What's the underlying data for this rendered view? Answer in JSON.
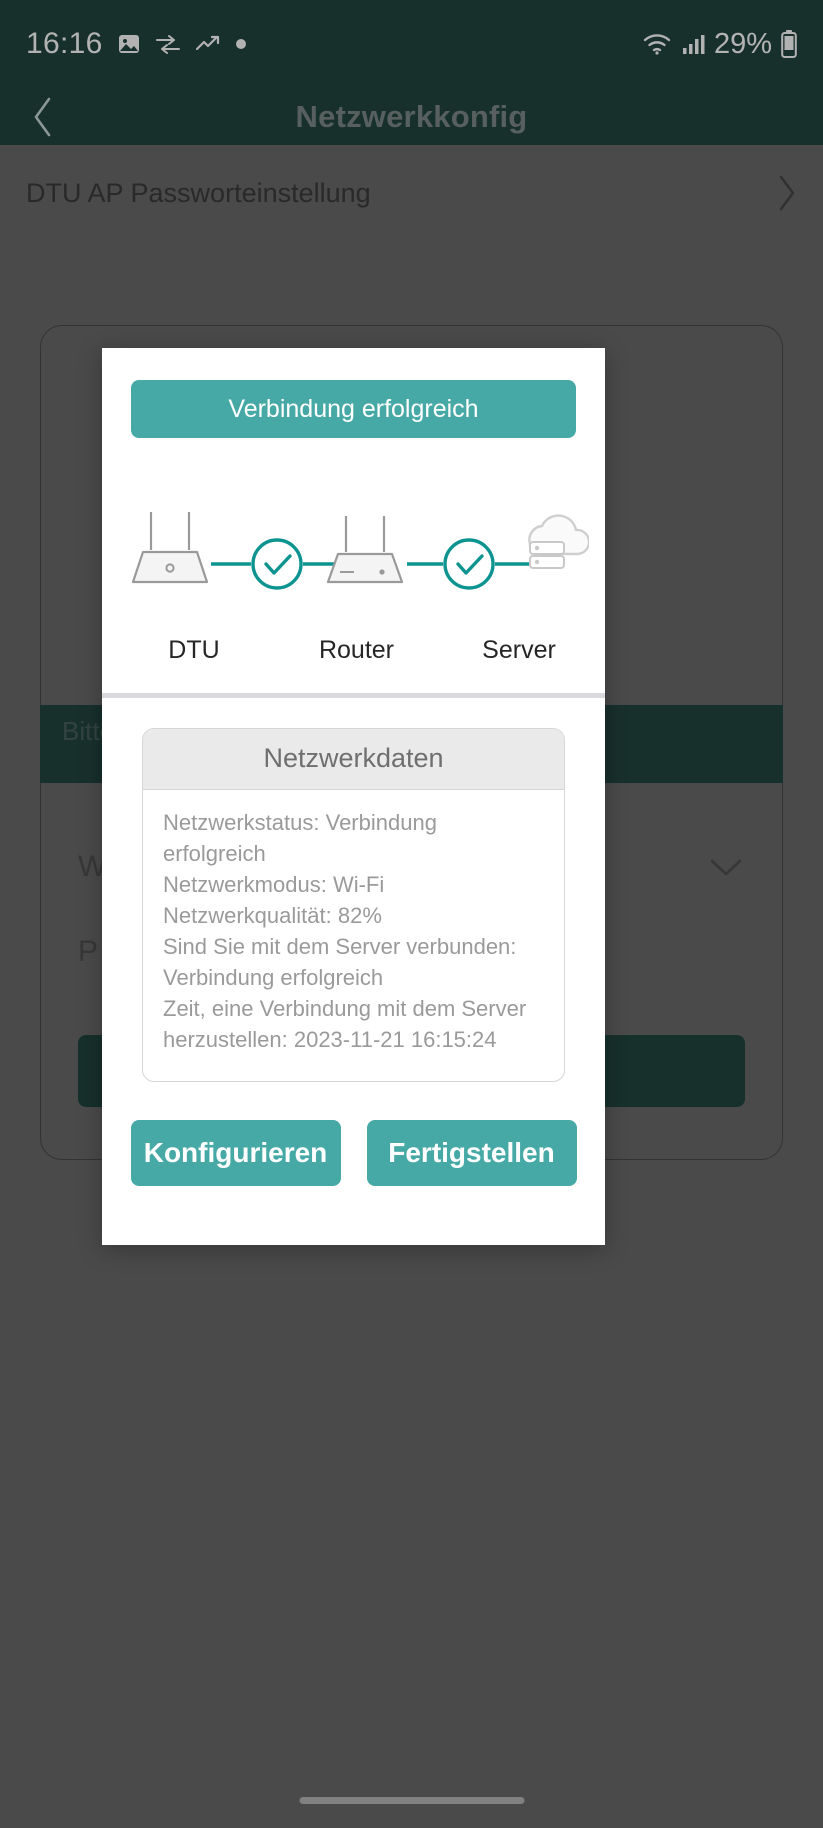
{
  "status_bar": {
    "time": "16:16",
    "battery_percent": "29%",
    "left_icons": [
      "image-icon",
      "data-transfer-icon",
      "trending-up-icon",
      "dot-icon"
    ],
    "right_icons": [
      "wifi-icon",
      "cellular-signal-icon",
      "battery-icon"
    ]
  },
  "app_bar": {
    "title": "Netzwerkkonfig",
    "back_icon": "chevron-left-icon"
  },
  "background_screen": {
    "row_label": "DTU AP Passworteinstellung",
    "row_chevron": "chevron-right-icon",
    "hint_text": "Bitte                                  Sie\ndas",
    "field_1": "W",
    "field_2": "P",
    "field_1_chevron": "chevron-down-icon"
  },
  "modal": {
    "banner_text": "Verbindung erfolgreich",
    "banner_color": "#46a9a6",
    "diagram": {
      "nodes": [
        {
          "id": "dtu",
          "label": "DTU",
          "icon": "router-device-icon"
        },
        {
          "id": "router",
          "label": "Router",
          "icon": "router-device-icon"
        },
        {
          "id": "server",
          "label": "Server",
          "icon": "cloud-server-icon"
        }
      ],
      "links": [
        {
          "from": "dtu",
          "to": "router",
          "state_icon": "check-circle-icon",
          "color": "#0e9490"
        },
        {
          "from": "router",
          "to": "server",
          "state_icon": "check-circle-icon",
          "color": "#0e9490"
        }
      ]
    },
    "data_panel": {
      "title": "Netzwerkdaten",
      "lines": [
        "Netzwerkstatus: Verbindung erfolgreich",
        "Netzwerkmodus: Wi-Fi",
        "Netzwerkqualität: 82%",
        "Sind Sie mit dem Server verbunden:",
        "Verbindung erfolgreich",
        "Zeit, eine Verbindung mit dem Server",
        "herzustellen: 2023-11-21 16:15:24"
      ]
    },
    "buttons": {
      "configure": "Konfigurieren",
      "finish": "Fertigstellen"
    }
  }
}
